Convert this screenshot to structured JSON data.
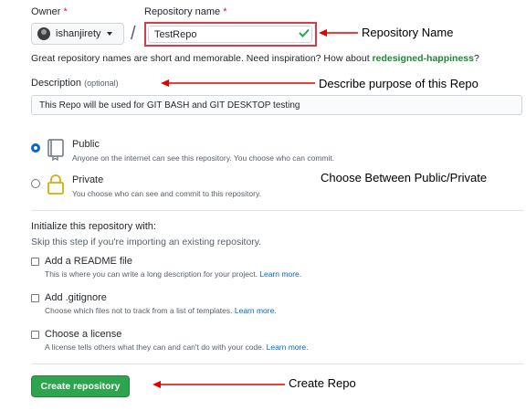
{
  "owner": {
    "label": "Owner",
    "required_mark": "*",
    "name": "ishanjirety"
  },
  "separator": "/",
  "repo_name": {
    "label": "Repository name",
    "required_mark": "*",
    "value": "TestRepo"
  },
  "hint": {
    "text": "Great repository names are short and memorable. Need inspiration? How about ",
    "suggestion": "redesigned-happiness",
    "end": "?"
  },
  "description": {
    "label": "Description",
    "optional": "(optional)",
    "value": "This Repo will be used for GIT BASH and GIT DESKTOP testing"
  },
  "visibility": {
    "public": {
      "title": "Public",
      "note": "Anyone on the internet can see this repository. You choose who can commit.",
      "selected": true
    },
    "private": {
      "title": "Private",
      "note": "You choose who can see and commit to this repository.",
      "selected": false
    }
  },
  "init": {
    "heading": "Initialize this repository with:",
    "subheading": "Skip this step if you're importing an existing repository.",
    "readme": {
      "title": "Add a README file",
      "note": "This is where you can write a long description for your project. ",
      "link": "Learn more."
    },
    "gitignore": {
      "title": "Add .gitignore",
      "note": "Choose which files not to track from a list of templates. ",
      "link": "Learn more."
    },
    "license": {
      "title": "Choose a license",
      "note": "A license tells others what they can and can't do with your code. ",
      "link": "Learn more."
    }
  },
  "create_button": "Create repository",
  "annotations": {
    "repo_name": "Repository Name",
    "description": "Describe purpose of this Repo",
    "visibility": "Choose Between Public/Private",
    "create": "Create Repo"
  },
  "colors": {
    "annotation_arrow": "#e00000",
    "primary_button": "#2ea44f",
    "link": "#0366d6",
    "suggestion": "#22863a",
    "highlight_border": "#d73a49"
  },
  "icons": {
    "owner_avatar": "avatar",
    "owner_dropdown": "caret-down-icon",
    "repo_valid": "check-icon",
    "public": "repo-icon",
    "private": "lock-icon"
  }
}
